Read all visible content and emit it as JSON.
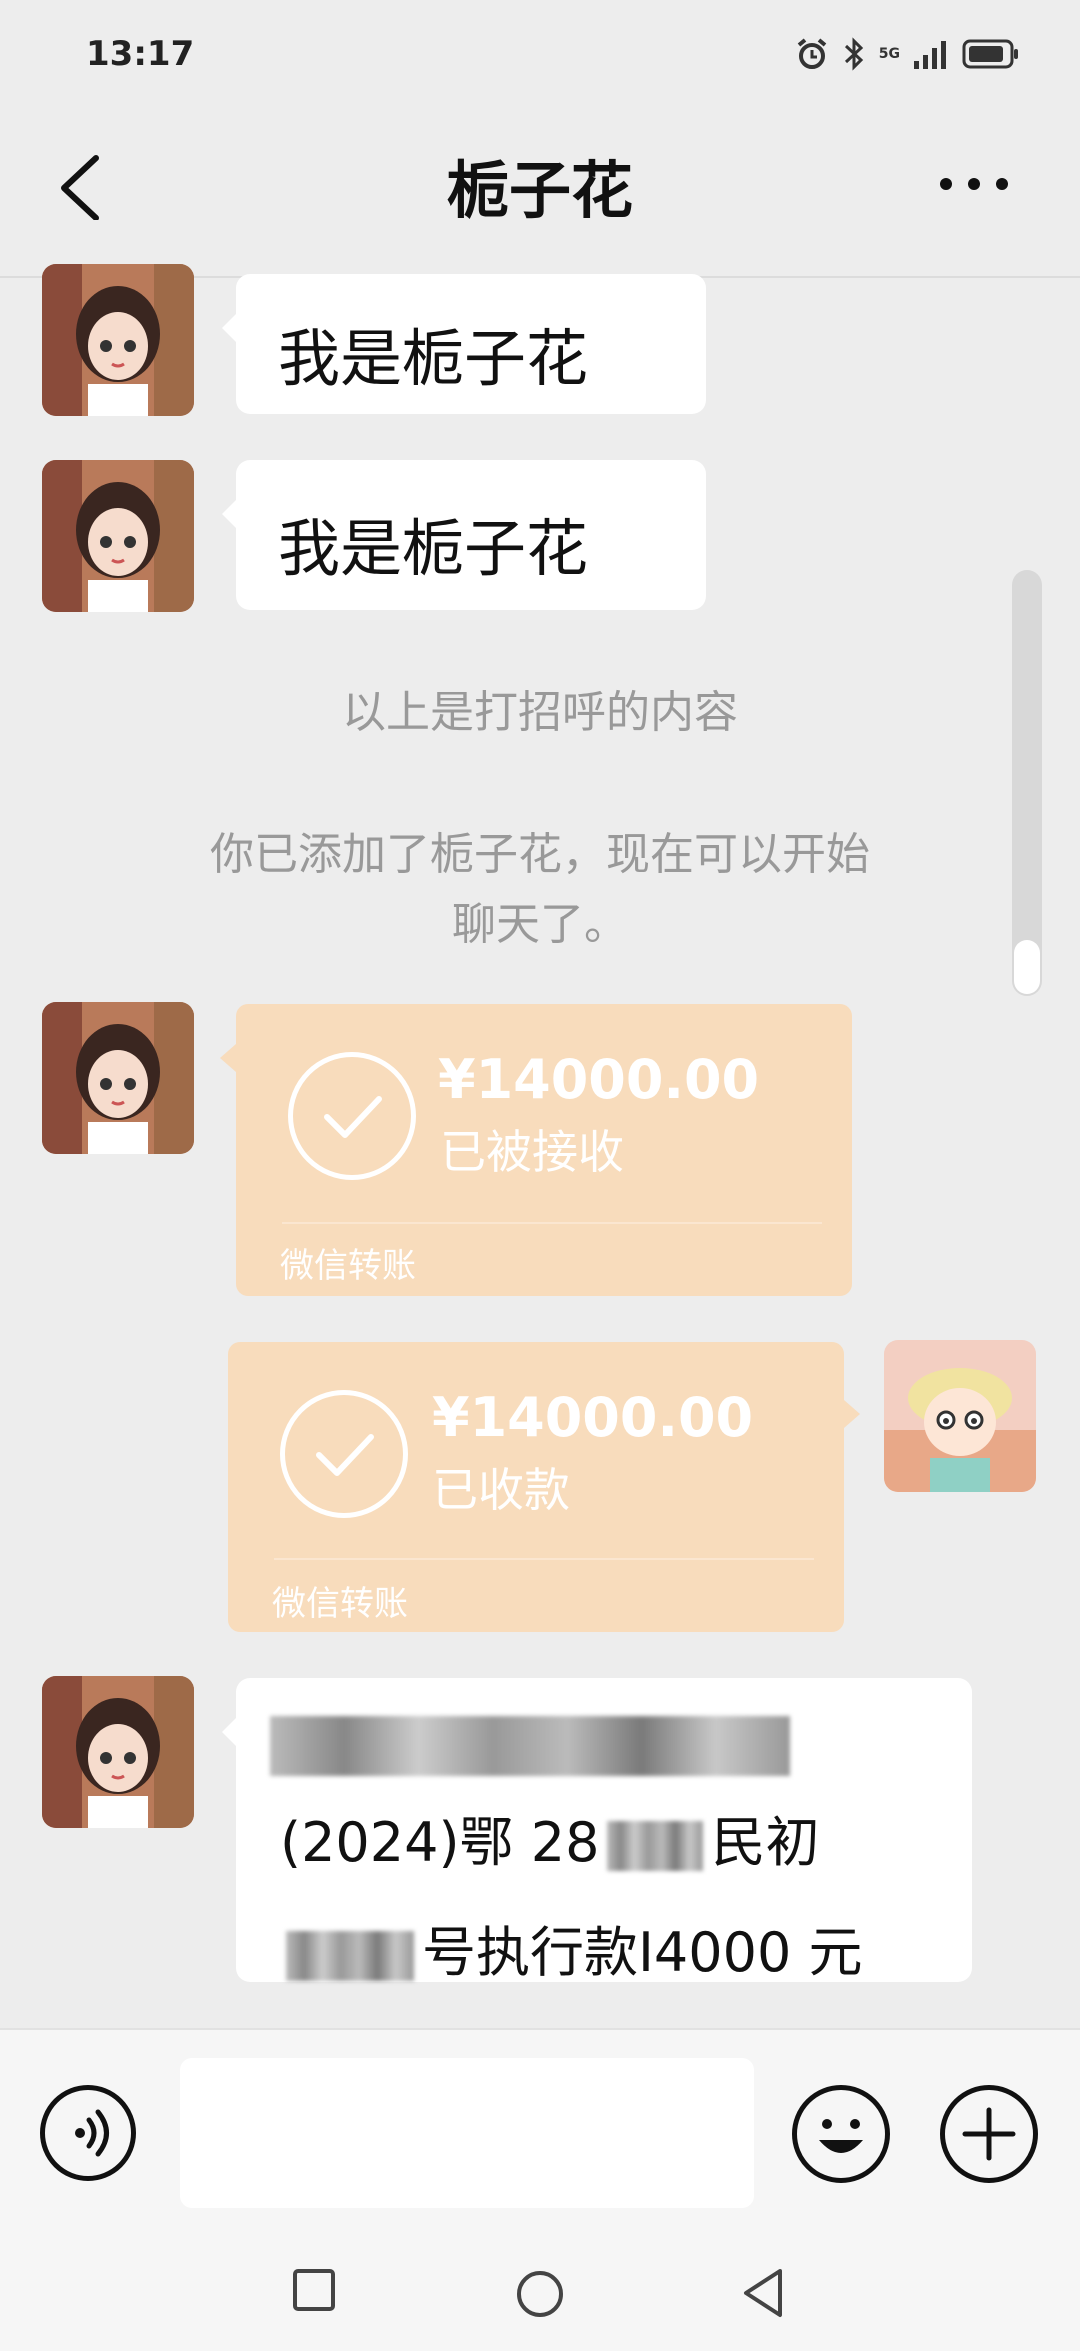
{
  "status": {
    "time": "13:17",
    "network": "5G"
  },
  "header": {
    "title": "栀子花"
  },
  "messages": {
    "m1": "我是栀子花",
    "m2": "我是栀子花",
    "sys1": "以上是打招呼的内容",
    "sys2_line1": "你已添加了栀子花，现在可以开始",
    "sys2_line2": "聊天了。",
    "transfer1": {
      "amount": "¥14000.00",
      "status": "已被接收",
      "footer": "微信转账"
    },
    "transfer2": {
      "amount": "¥14000.00",
      "status": "已收款",
      "footer": "微信转账"
    },
    "m3_line2_a": "(2024)鄂 28",
    "m3_line2_b": "民初",
    "m3_line3": "号执行款I4000 元"
  },
  "colors": {
    "background": "#ededed",
    "transfer": "#f8dcbc",
    "bubble": "#ffffff"
  },
  "icons": [
    "back-icon",
    "more-icon",
    "voice-icon",
    "emoji-icon",
    "plus-icon",
    "check-icon"
  ]
}
